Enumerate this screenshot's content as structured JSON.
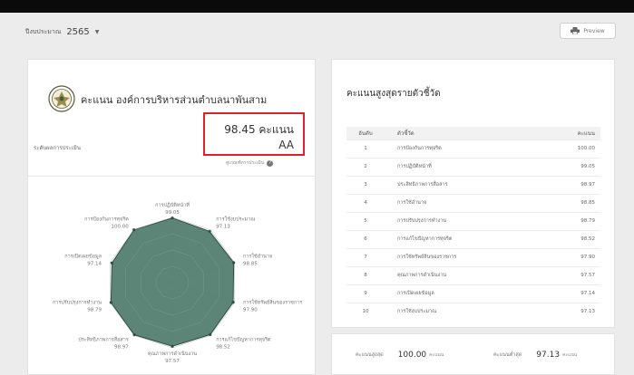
{
  "header": {
    "fiscal_year_label": "ปีงบประมาณ",
    "fiscal_year_value": "2565",
    "preview_label": "Preview"
  },
  "overview": {
    "title": "คะแนน องค์การบริหารส่วนตำบลนาพันสาม",
    "score": "98.45 คะแนน",
    "level_label": "ระดับผลการประเมิน",
    "level": "AA",
    "info_link": "ดูเกณฑ์การประเมิน"
  },
  "radar_labels": [
    {
      "name": "การปฏิบัติหน้าที่",
      "score": "99.05"
    },
    {
      "name": "การใช้งบประมาณ",
      "score": "97.13"
    },
    {
      "name": "การใช้อำนาจ",
      "score": "98.85"
    },
    {
      "name": "การใช้ทรัพย์สินของราชการ",
      "score": "97.90"
    },
    {
      "name": "การแก้ไขปัญหาการทุจริต",
      "score": "98.52"
    },
    {
      "name": "คุณภาพการดำเนินงาน",
      "score": "97.57"
    },
    {
      "name": "ประสิทธิภาพการสื่อสาร",
      "score": "98.97"
    },
    {
      "name": "การปรับปรุงการทำงาน",
      "score": "98.79"
    },
    {
      "name": "การเปิดเผยข้อมูล",
      "score": "97.14"
    },
    {
      "name": "การป้องกันการทุจริต",
      "score": "100.00"
    }
  ],
  "ranking": {
    "title": "คะแนนสูงสุดรายตัวชี้วัด",
    "headers": {
      "rank": "อันดับ",
      "indicator": "ตัวชี้วัด",
      "score": "คะแนน"
    },
    "rows": [
      {
        "rank": "1",
        "name": "การป้องกันการทุจริต",
        "score": "100.00"
      },
      {
        "rank": "2",
        "name": "การปฏิบัติหน้าที่",
        "score": "99.05"
      },
      {
        "rank": "3",
        "name": "ประสิทธิภาพการสื่อสาร",
        "score": "98.97"
      },
      {
        "rank": "4",
        "name": "การใช้อำนาจ",
        "score": "98.85"
      },
      {
        "rank": "5",
        "name": "การปรับปรุงการทำงาน",
        "score": "98.79"
      },
      {
        "rank": "6",
        "name": "การแก้ไขปัญหาการทุจริต",
        "score": "98.52"
      },
      {
        "rank": "7",
        "name": "การใช้ทรัพย์สินของราชการ",
        "score": "97.90"
      },
      {
        "rank": "8",
        "name": "คุณภาพการดำเนินงาน",
        "score": "97.57"
      },
      {
        "rank": "9",
        "name": "การเปิดเผยข้อมูล",
        "score": "97.14"
      },
      {
        "rank": "10",
        "name": "การใช้งบประมาณ",
        "score": "97.13"
      }
    ]
  },
  "stats": {
    "max_label": "คะแนนสูงสุด",
    "max_value": "100.00",
    "min_label": "คะแนนต่ำสุด",
    "min_value": "97.13",
    "unit": "คะแนน"
  },
  "chart_data": {
    "type": "radar",
    "categories": [
      "การปฏิบัติหน้าที่",
      "การใช้งบประมาณ",
      "การใช้อำนาจ",
      "การใช้ทรัพย์สินของราชการ",
      "การแก้ไขปัญหาการทุจริต",
      "คุณภาพการดำเนินงาน",
      "ประสิทธิภาพการสื่อสาร",
      "การปรับปรุงการทำงาน",
      "การเปิดเผยข้อมูล",
      "การป้องกันการทุจริต"
    ],
    "values": [
      99.05,
      97.13,
      98.85,
      97.9,
      98.52,
      97.57,
      98.97,
      98.79,
      97.14,
      100.0
    ],
    "range": [
      0,
      100
    ],
    "rings": 4,
    "fill_color": "#4e7a6b",
    "stroke_color": "#2f4f45"
  }
}
